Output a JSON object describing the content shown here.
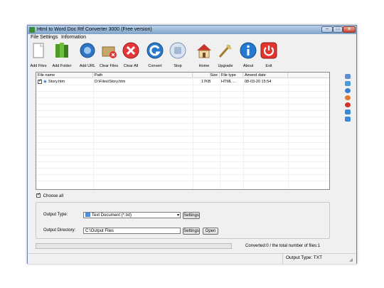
{
  "window": {
    "title": "Html to Word Doc Rtf Converter 3000 (Free version)"
  },
  "menu": [
    "File",
    "Settings",
    "Information"
  ],
  "toolbar": [
    {
      "label": "Add Files",
      "icon": "add-files-icon"
    },
    {
      "label": "Add Folder",
      "icon": "add-folder-icon"
    },
    {
      "label": "Add URL",
      "icon": "add-url-icon"
    },
    {
      "label": "Clear Files",
      "icon": "clear-files-icon"
    },
    {
      "label": "Clear All",
      "icon": "clear-all-icon"
    },
    {
      "label": "Convert",
      "icon": "convert-icon"
    },
    {
      "label": "Stop",
      "icon": "stop-icon"
    },
    {
      "label": "Home",
      "icon": "home-icon"
    },
    {
      "label": "Upgrade",
      "icon": "upgrade-icon"
    },
    {
      "label": "About",
      "icon": "about-icon"
    },
    {
      "label": "Exit",
      "icon": "exit-icon"
    }
  ],
  "file_list": {
    "columns": [
      "File name",
      "Path",
      "Size",
      "File type",
      "Amend date"
    ],
    "rows": [
      {
        "name": "Story.htm",
        "path": "D:\\Files\\Story.htm",
        "size": "17KB",
        "type": "HTML ...",
        "date": "08-03-20 15:54"
      }
    ]
  },
  "choose_all": "Choose all",
  "output": {
    "type_label": "Output Type:",
    "type_value": "Text Document (*.txt)",
    "type_settings": "Settings",
    "dir_label": "Output Directory:",
    "dir_value": "C:\\Output Files",
    "dir_settings": "Settings",
    "open": "Open"
  },
  "status": {
    "converted": "Converted:0  /  the total number of files:1",
    "output_type": "Output Type: TXT"
  },
  "colors": {
    "title_gradient_top": "#b9d1ea",
    "title_gradient_bottom": "#7fa2c8",
    "close_red": "#c4452c"
  }
}
